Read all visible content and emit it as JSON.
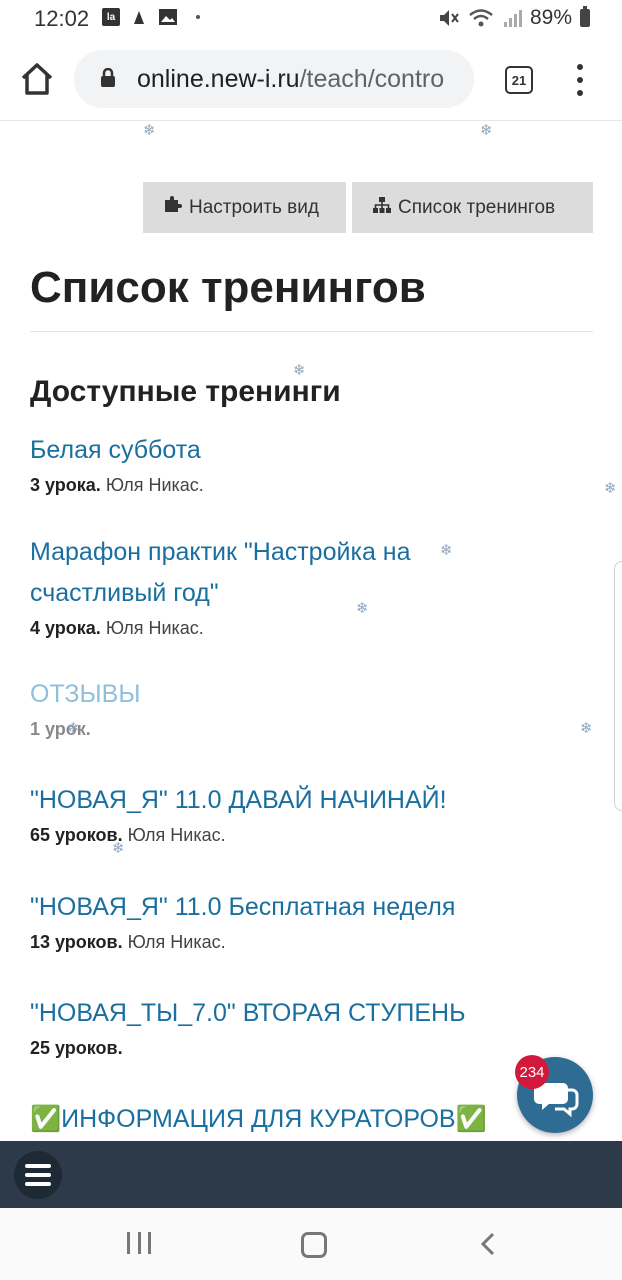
{
  "status_bar": {
    "time": "12:02",
    "battery": "89%",
    "left_icons": [
      "la-app-icon",
      "bird-app-icon",
      "gallery-icon",
      "dot"
    ],
    "right_icons": [
      "mute-icon",
      "wifi-icon",
      "signal-icon",
      "battery-icon"
    ]
  },
  "browser": {
    "url_domain": "online.new-i.ru",
    "url_path": "/teach/contro",
    "tab_count": "21"
  },
  "toolbar": {
    "customize_label": "Настроить вид",
    "trainings_list_label": "Список тренингов"
  },
  "page": {
    "title": "Список тренингов",
    "section_title": "Доступные тренинги"
  },
  "trainings": [
    {
      "title": "Белая суббота",
      "lessons": "3 урока.",
      "author": "Юля Никас."
    },
    {
      "title": "Марафон практик \"Настройка на счастливый год\"",
      "lessons": "4 урока.",
      "author": "Юля Никас."
    },
    {
      "title": "ОТЗЫВЫ",
      "lessons": "1 урок.",
      "author": ""
    },
    {
      "title": "\"НОВАЯ_Я\" 11.0 ДАВАЙ НАЧИНАЙ!",
      "lessons": "65 уроков.",
      "author": "Юля Никас."
    },
    {
      "title": "\"НОВАЯ_Я\" 11.0 Бесплатная неделя",
      "lessons": "13 уроков.",
      "author": "Юля Никас."
    },
    {
      "title": "\"НОВАЯ_ТЫ_7.0\" ВТОРАЯ СТУПЕНЬ",
      "lessons": "25 уроков.",
      "author": ""
    },
    {
      "title": "✅ИНФОРМАЦИЯ ДЛЯ КУРАТОРОВ✅",
      "lessons": "",
      "author": ""
    }
  ],
  "chat": {
    "badge_count": "234"
  },
  "colors": {
    "link": "#1a6fa0",
    "muted_link": "#8ec0dd",
    "site_bar": "#2c3a4a",
    "chat_button": "#2f6c94",
    "badge": "#d3193b"
  }
}
